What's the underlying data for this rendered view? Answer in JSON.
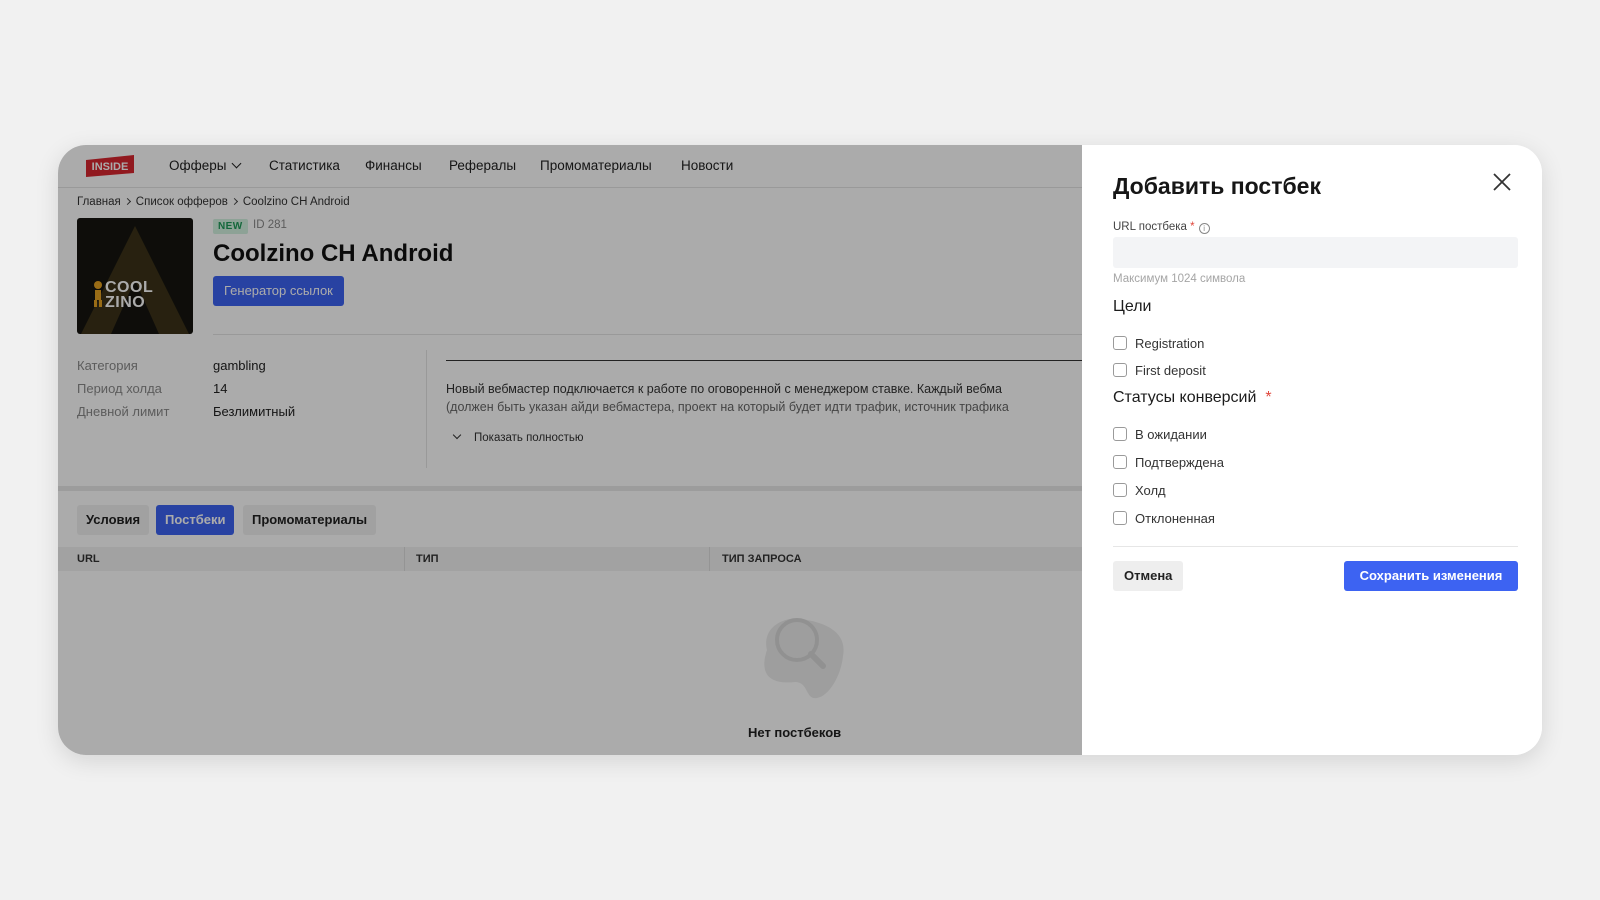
{
  "nav": {
    "logo_text": "INSIDE",
    "items": [
      "Офферы",
      "Статистика",
      "Финансы",
      "Рефералы",
      "Промоматериалы",
      "Новости"
    ]
  },
  "breadcrumb": [
    "Главная",
    "Список офферов",
    "Coolzino CH Android"
  ],
  "offer": {
    "image_brand_line1": "COOL",
    "image_brand_line2": "ZINO",
    "badge": "NEW",
    "id": "ID 281",
    "title": "Coolzino CH Android",
    "generate_button": "Генератор ссылок",
    "info": [
      {
        "key": "Категория",
        "value": "gambling"
      },
      {
        "key": "Период холда",
        "value": "14"
      },
      {
        "key": "Дневной лимит",
        "value": "Безлимитный"
      }
    ],
    "description_line1": "Новый вебмастер подключается к работе по оговоренной с менеджером ставке. Каждый вебма",
    "description_line2": "(должен быть указан айди вебмастера, проект на который будет идти трафик, источник трафика",
    "show_more": "Показать полностью"
  },
  "tabs": [
    {
      "label": "Условия",
      "active": false
    },
    {
      "label": "Постбеки",
      "active": true
    },
    {
      "label": "Промоматериалы",
      "active": false
    }
  ],
  "table": {
    "columns": [
      "URL",
      "ТИП",
      "ТИП ЗАПРОСА"
    ],
    "empty_text": "Нет постбеков"
  },
  "drawer": {
    "title": "Добавить постбек",
    "url_label": "URL постбека",
    "required_mark": "*",
    "info_glyph": "i",
    "url_value": "",
    "url_hint": "Максимум 1024 символа",
    "goals_title": "Цели",
    "goals": [
      {
        "label": "Registration",
        "checked": false
      },
      {
        "label": "First deposit",
        "checked": false
      }
    ],
    "statuses_title": "Статусы конверсий",
    "statuses": [
      {
        "label": "В ожидании",
        "checked": false
      },
      {
        "label": "Подтверждена",
        "checked": false
      },
      {
        "label": "Холд",
        "checked": false
      },
      {
        "label": "Отклоненная",
        "checked": false
      }
    ],
    "cancel_button": "Отмена",
    "save_button": "Сохранить изменения"
  },
  "colors": {
    "accent": "#3d63f2",
    "required": "#e0463b",
    "logo": "#d8262f",
    "badge_bg": "#d3f2e0",
    "badge_text": "#1f9a59"
  }
}
